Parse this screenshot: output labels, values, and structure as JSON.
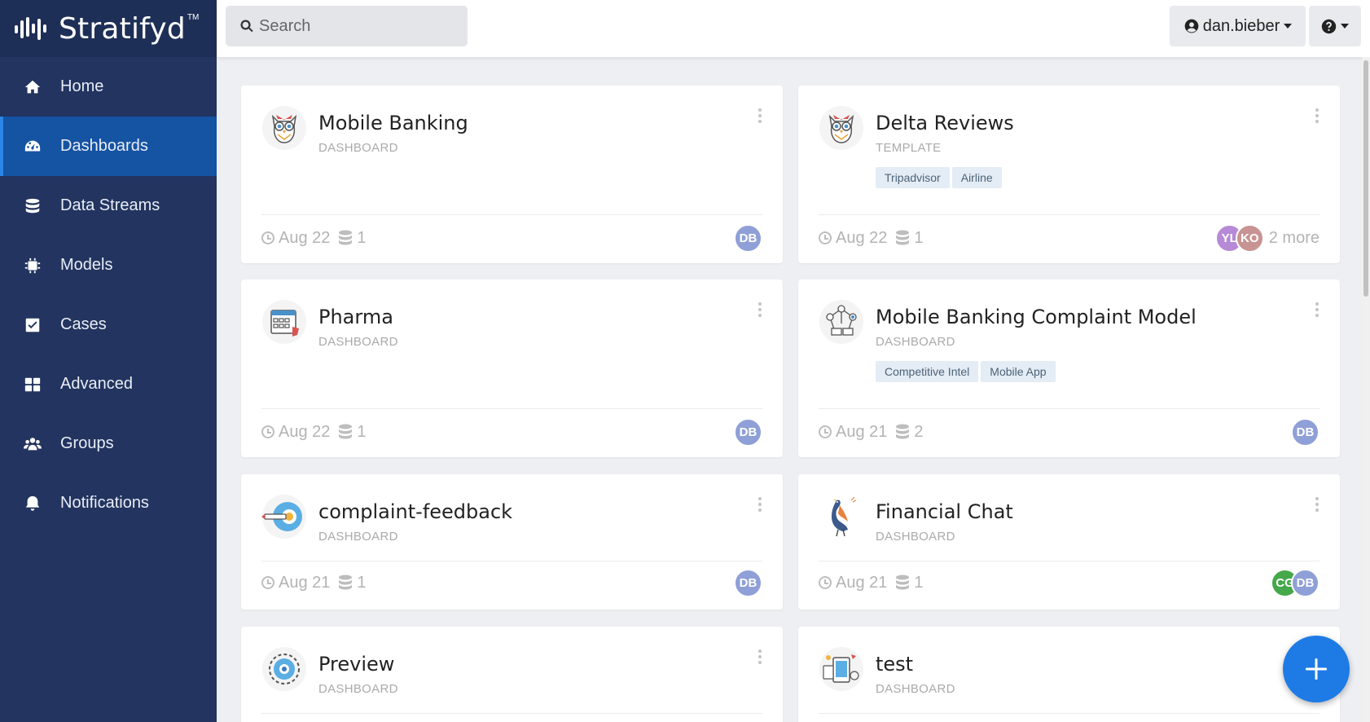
{
  "brand": {
    "name": "Stratifyd",
    "tm": "TM",
    "logo_icon": "stratifyd-bars-logo"
  },
  "nav": [
    {
      "label": "Home",
      "icon": "home-icon",
      "active": false
    },
    {
      "label": "Dashboards",
      "icon": "dashboard-gauge-icon",
      "active": true
    },
    {
      "label": "Data Streams",
      "icon": "database-icon",
      "active": false
    },
    {
      "label": "Models",
      "icon": "chip-icon",
      "active": false
    },
    {
      "label": "Cases",
      "icon": "check-square-icon",
      "active": false
    },
    {
      "label": "Advanced",
      "icon": "grid-icon",
      "active": false
    },
    {
      "label": "Groups",
      "icon": "users-icon",
      "active": false
    },
    {
      "label": "Notifications",
      "icon": "bell-icon",
      "active": false
    }
  ],
  "search": {
    "placeholder": "Search",
    "value": ""
  },
  "user": {
    "name": "dan.bieber"
  },
  "colors": {
    "sidebar": "#22345f",
    "active_nav": "#1553a3",
    "fab": "#1e7be6",
    "avatar_db": "#8f9fd7",
    "avatar_yl": "#b68ad6",
    "avatar_ko": "#c89393",
    "avatar_cg": "#45a84a"
  },
  "cards": [
    {
      "title": "Mobile Banking",
      "type": "DASHBOARD",
      "thumb": "owl",
      "tags": [],
      "date": "Aug 22",
      "streams": "1",
      "avatars": [
        {
          "initials": "DB",
          "color": "#8f9fd7"
        }
      ],
      "more": ""
    },
    {
      "title": "Delta Reviews",
      "type": "TEMPLATE",
      "thumb": "owl",
      "tags": [
        "Tripadvisor",
        "Airline"
      ],
      "date": "Aug 22",
      "streams": "1",
      "avatars": [
        {
          "initials": "YL",
          "color": "#b68ad6"
        },
        {
          "initials": "KO",
          "color": "#c89393"
        }
      ],
      "more": "2 more"
    },
    {
      "title": "Pharma",
      "type": "DASHBOARD",
      "thumb": "calendar",
      "tags": [],
      "date": "Aug 22",
      "streams": "1",
      "avatars": [
        {
          "initials": "DB",
          "color": "#8f9fd7"
        }
      ],
      "more": ""
    },
    {
      "title": "Mobile Banking Complaint Model",
      "type": "DASHBOARD",
      "thumb": "network",
      "tags": [
        "Competitive Intel",
        "Mobile App"
      ],
      "date": "Aug 21",
      "streams": "2",
      "avatars": [
        {
          "initials": "DB",
          "color": "#8f9fd7"
        }
      ],
      "more": ""
    },
    {
      "title": "complaint-feedback",
      "type": "DASHBOARD",
      "thumb": "target",
      "tags": [],
      "date": "Aug 21",
      "streams": "1",
      "avatars": [
        {
          "initials": "DB",
          "color": "#8f9fd7"
        }
      ],
      "more": ""
    },
    {
      "title": "Financial Chat",
      "type": "DASHBOARD",
      "thumb": "bird",
      "tags": [],
      "date": "Aug 21",
      "streams": "1",
      "avatars": [
        {
          "initials": "CG",
          "color": "#45a84a"
        },
        {
          "initials": "DB",
          "color": "#8f9fd7"
        }
      ],
      "more": ""
    },
    {
      "title": "Preview",
      "type": "DASHBOARD",
      "thumb": "gear",
      "tags": [],
      "date": "",
      "streams": "",
      "avatars": [],
      "more": ""
    },
    {
      "title": "test",
      "type": "DASHBOARD",
      "thumb": "devices",
      "tags": [],
      "date": "",
      "streams": "",
      "avatars": [],
      "more": ""
    }
  ]
}
